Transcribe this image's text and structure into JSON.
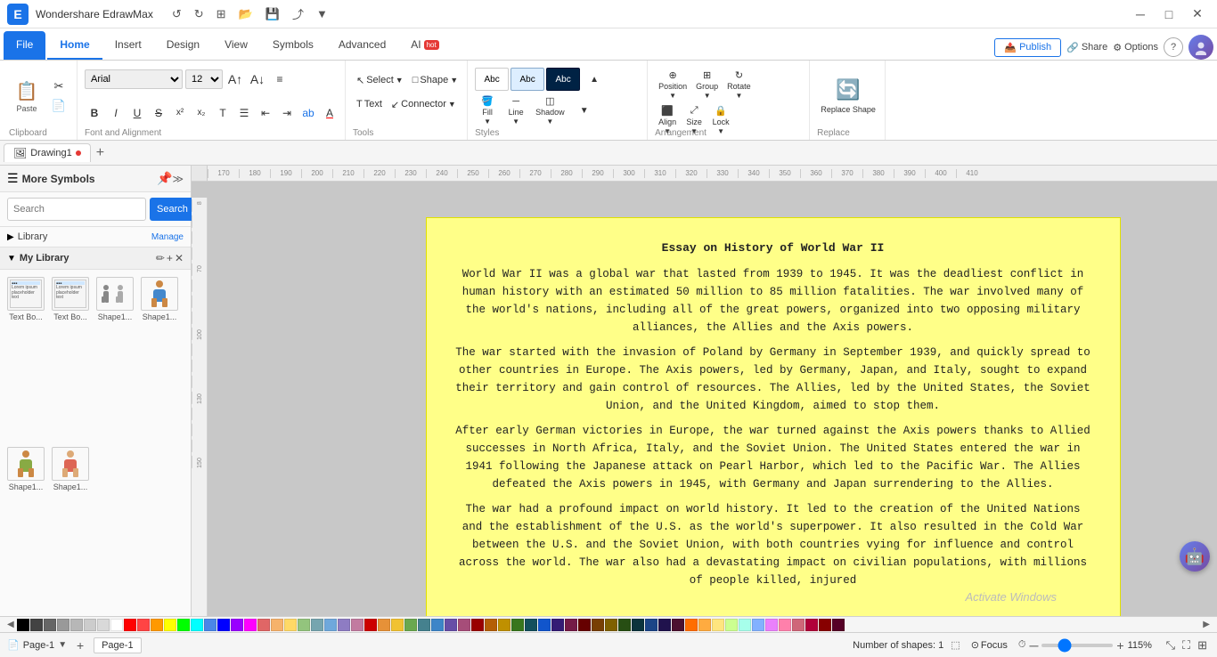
{
  "app": {
    "title": "Wondershare EdrawMax",
    "logo_icon": "⬡"
  },
  "titlebar": {
    "undo_label": "↺",
    "redo_label": "↻",
    "new_label": "⊞",
    "open_label": "📂",
    "save_label": "💾",
    "export_label": "⤴",
    "more_label": "▼",
    "minimize": "─",
    "maximize": "□",
    "close": "✕"
  },
  "tabs": [
    {
      "id": "file",
      "label": "File",
      "active": false,
      "file_style": true
    },
    {
      "id": "home",
      "label": "Home",
      "active": true
    },
    {
      "id": "insert",
      "label": "Insert",
      "active": false
    },
    {
      "id": "design",
      "label": "Design",
      "active": false
    },
    {
      "id": "view",
      "label": "View",
      "active": false
    },
    {
      "id": "symbols",
      "label": "Symbols",
      "active": false
    },
    {
      "id": "advanced",
      "label": "Advanced",
      "active": false
    },
    {
      "id": "ai",
      "label": "AI",
      "active": false,
      "badge": "hot"
    }
  ],
  "header_right": {
    "publish": "Publish",
    "share": "Share",
    "options": "Options",
    "help": "?"
  },
  "ribbon": {
    "clipboard_label": "Clipboard",
    "font_alignment_label": "Font and Alignment",
    "tools_label": "Tools",
    "styles_label": "Styles",
    "arrangement_label": "Arrangement",
    "replace_label": "Replace",
    "clipboard_btns": [
      {
        "icon": "✂",
        "label": ""
      },
      {
        "icon": "📋",
        "label": ""
      }
    ],
    "paste_icon": "📋",
    "font_name": "Arial",
    "font_size": "12",
    "bold": "B",
    "italic": "I",
    "underline": "U",
    "strikethrough": "S",
    "superscript": "x²",
    "subscript": "x₂",
    "text_format": "T",
    "align_icon": "≡",
    "indent_inc": "⇥",
    "indent_dec": "⇤",
    "highlight_color": "ab",
    "font_color": "A",
    "select_label": "Select",
    "shape_label": "Shape",
    "text_label": "Text",
    "connector_label": "Connector",
    "fill_label": "Fill",
    "line_label": "Line",
    "shadow_label": "Shadow",
    "position_label": "Position",
    "group_label": "Group",
    "rotate_label": "Rotate",
    "align_label": "Align",
    "size_label": "Size",
    "lock_label": "Lock",
    "replace_shape_label": "Replace Shape",
    "style_swatches": [
      {
        "color": "#ffffff",
        "border": "#aaa",
        "text": "Abc"
      },
      {
        "color": "#cce5ff",
        "border": "#88c",
        "text": "Abc"
      },
      {
        "color": "#003366",
        "border": "#002244",
        "text": "Abc"
      }
    ]
  },
  "sidebar": {
    "title": "More Symbols",
    "search_placeholder": "Search",
    "search_btn": "Search",
    "library_label": "Library",
    "manage_label": "Manage",
    "my_library_label": "My Library",
    "items": [
      {
        "label": "Text Bo...",
        "type": "text",
        "icon": "📄"
      },
      {
        "label": "Text Bo...",
        "type": "text",
        "icon": "📄"
      },
      {
        "label": "Shape1...",
        "type": "shape",
        "icon": "👥"
      },
      {
        "label": "Shape1...",
        "type": "shape",
        "icon": "👤"
      },
      {
        "label": "Shape1...",
        "type": "shape",
        "icon": "👤"
      }
    ]
  },
  "document": {
    "tab_name": "Drawing1",
    "modified": true
  },
  "essay": {
    "title": "Essay on History of World War II",
    "paragraphs": [
      "World War II was a global war that lasted from 1939 to 1945. It was the deadliest conflict in human history with an estimated 50 million to 85 million fatalities. The war involved many of the world's nations, including all of the great powers, organized into two opposing military alliances, the Allies and the Axis powers.",
      "The war started with the invasion of Poland by Germany in September 1939, and quickly spread to other countries in Europe. The Axis powers, led by Germany, Japan, and Italy, sought to expand their territory and gain control of resources. The Allies, led by the United States, the Soviet Union, and the United Kingdom, aimed to stop them.",
      "After early German victories in Europe, the war turned against the Axis powers thanks to Allied successes in North Africa, Italy, and the Soviet Union. The United States entered the war in 1941 following the Japanese attack on Pearl Harbor, which led to the Pacific War. The Allies defeated the Axis powers in 1945, with Germany and Japan surrendering to the Allies.",
      "The war had a profound impact on world history. It led to the creation of the United Nations and the establishment of the U.S. as the world's superpower. It also resulted in the Cold War between the U.S. and the Soviet Union, with both countries vying for influence and control across the world. The war also had a devastating impact on civilian populations, with millions of people killed, injured"
    ]
  },
  "statusbar": {
    "page_label": "Page-1",
    "shapes_count": "Number of shapes: 1",
    "focus_label": "Focus",
    "zoom_level": "115%",
    "zoom_in": "+",
    "zoom_out": "─"
  },
  "watermark": "Activate Windows",
  "ruler_marks": [
    "170",
    "180",
    "190",
    "200",
    "210",
    "220",
    "230",
    "240",
    "250",
    "260",
    "270",
    "280",
    "290",
    "300",
    "310",
    "320",
    "330",
    "340",
    "350",
    "360",
    "370",
    "380",
    "390",
    "400",
    "410"
  ],
  "colors": [
    "#000000",
    "#434343",
    "#666666",
    "#999999",
    "#b7b7b7",
    "#cccccc",
    "#d9d9d9",
    "#ffffff",
    "#ff0000",
    "#ff4444",
    "#ff9900",
    "#ffff00",
    "#00ff00",
    "#00ffff",
    "#4a86e8",
    "#0000ff",
    "#9900ff",
    "#ff00ff",
    "#e06666",
    "#f6b26b",
    "#ffd966",
    "#93c47d",
    "#76a5af",
    "#6fa8dc",
    "#8e7cc3",
    "#c27ba0",
    "#cc0000",
    "#e69138",
    "#f1c232",
    "#6aa84f",
    "#45818e",
    "#3d85c8",
    "#674ea7",
    "#a64d79",
    "#990000",
    "#b45f06",
    "#bf9000",
    "#38761d",
    "#134f5c",
    "#1155cc",
    "#351c75",
    "#741b47",
    "#660000",
    "#783f04",
    "#7f6000",
    "#274e13",
    "#0c343d",
    "#1c4587",
    "#20124d",
    "#4c1130",
    "#ff6d00",
    "#ffab40",
    "#ffe57f",
    "#ccff90",
    "#a7ffeb",
    "#82b1ff",
    "#ea80fc",
    "#ff80ab",
    "#cf6679",
    "#b0003a",
    "#870000",
    "#560027"
  ]
}
